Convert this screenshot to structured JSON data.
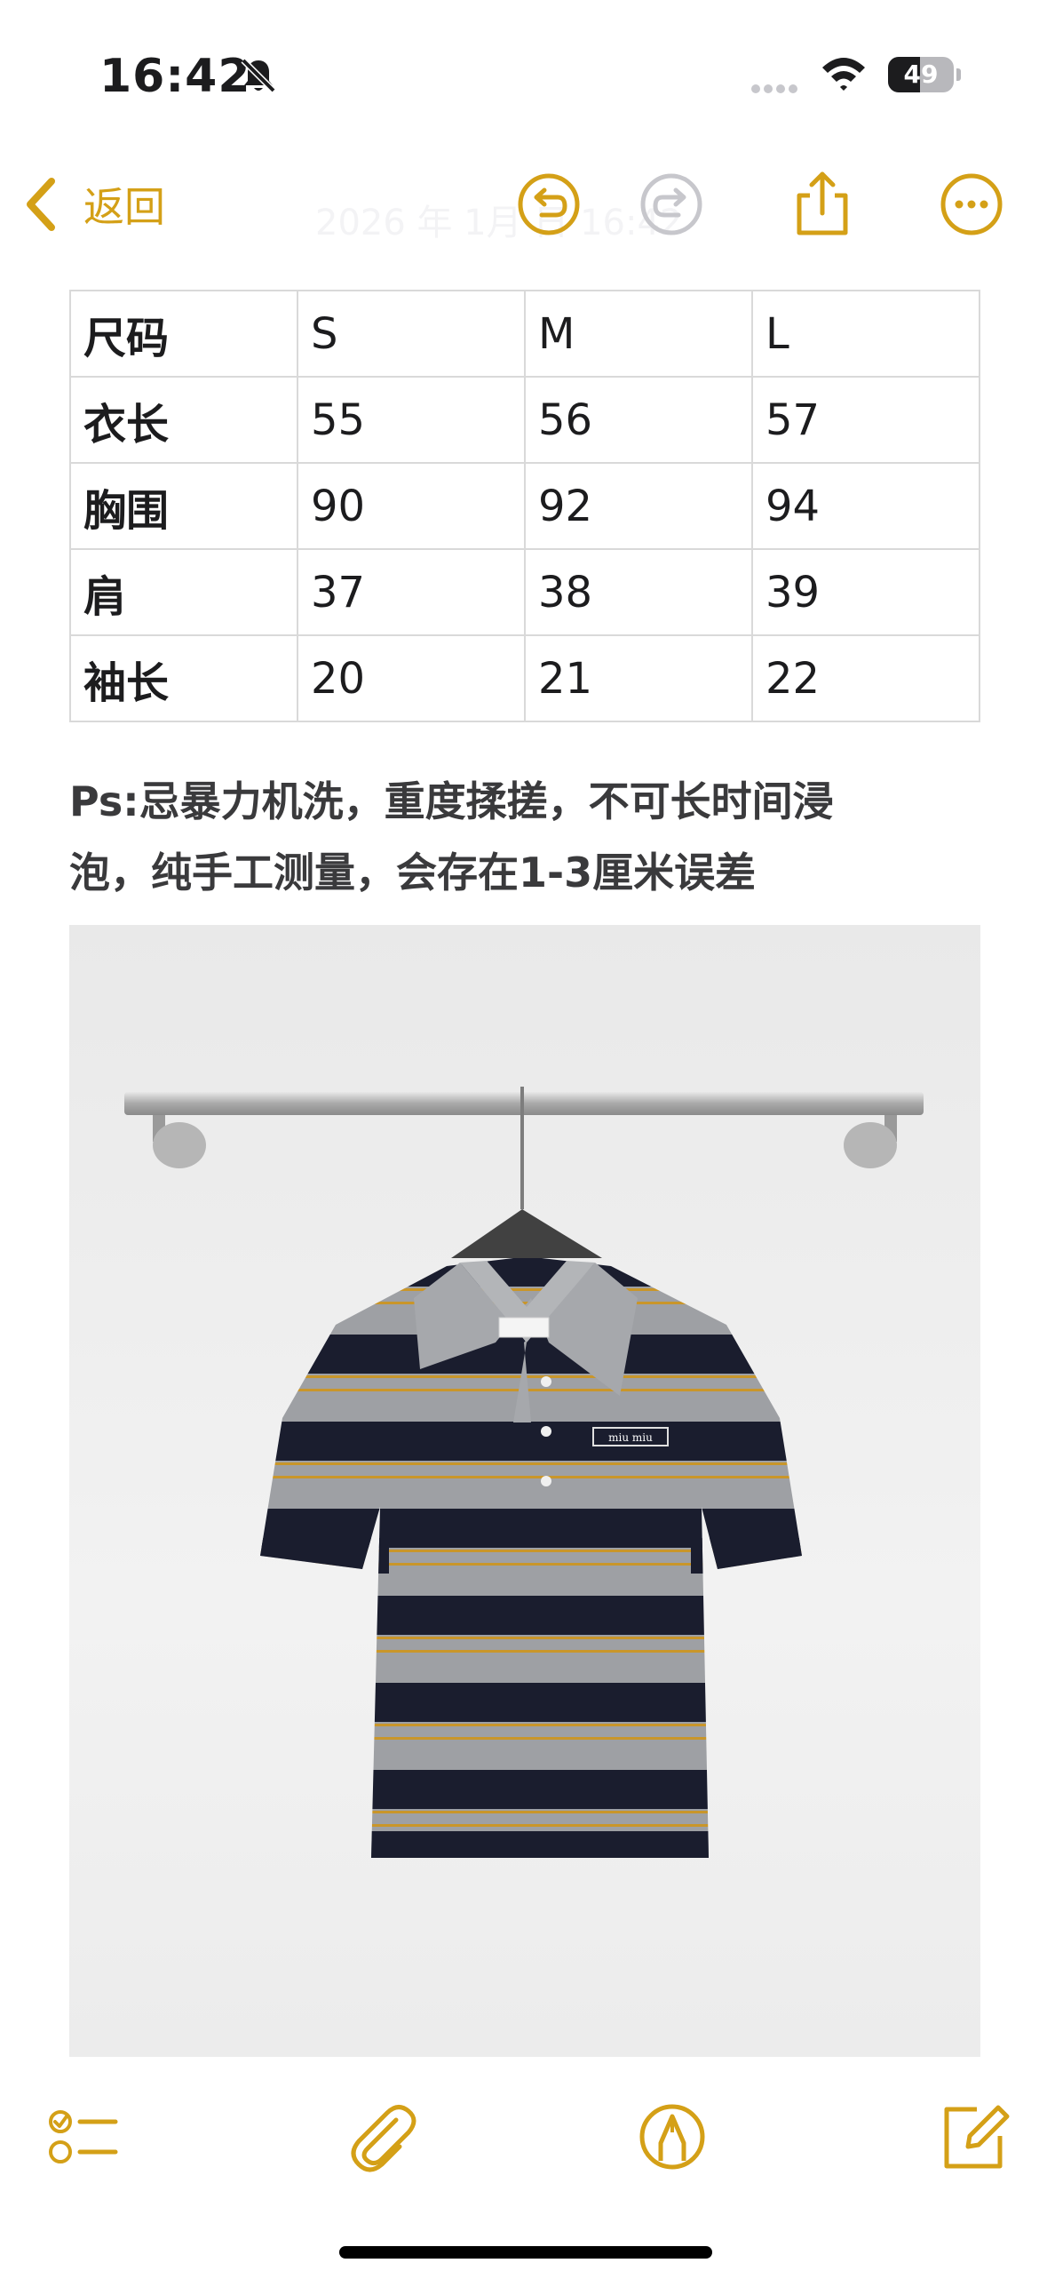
{
  "status_bar": {
    "time": "16:42",
    "battery_level": "49",
    "icons": [
      "bell-slash-icon",
      "cellular-signal-icon",
      "wifi-icon",
      "battery-icon"
    ]
  },
  "nav": {
    "back_label": "返回",
    "date_faint": "2026 年 1月 日 16:42",
    "icons": [
      "chevron-left-icon",
      "undo-icon",
      "redo-icon",
      "share-icon",
      "more-icon"
    ]
  },
  "size_table": {
    "header": [
      "尺码",
      "S",
      "M",
      "L"
    ],
    "rows": [
      [
        "衣长",
        "55",
        "56",
        "57"
      ],
      [
        "胸围",
        "90",
        "92",
        "94"
      ],
      [
        "肩",
        "37",
        "38",
        "39"
      ],
      [
        "袖长",
        "20",
        "21",
        "22"
      ]
    ]
  },
  "note": {
    "line1": "Ps:忌暴力机洗，重度揉搓，不可长时间浸",
    "line2": "泡，纯手工测量，会存在1-3厘米误差"
  },
  "photo": {
    "label_text": "miu miu"
  },
  "toolbar": {
    "icons": [
      "checklist-icon",
      "paperclip-icon",
      "markup-pen-icon",
      "compose-icon"
    ]
  },
  "colors": {
    "accent": "#d4a017",
    "text": "#1c1c1e",
    "table_border": "#d9d9d9",
    "stripe_navy": "#1a1d2e",
    "stripe_grey": "#9ea0a4",
    "stripe_gold": "#c9962a"
  }
}
